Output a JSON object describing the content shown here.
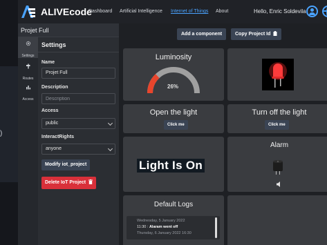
{
  "navbar": {
    "brand": "ALIVEcode",
    "links": [
      "Dashboard",
      "Artificial Intelligence",
      "Internet of Things",
      "About"
    ],
    "active_link": "Internet of Things",
    "user_name": "Hello, Enric Soldevila"
  },
  "project": {
    "title": "Projet Full"
  },
  "side_tabs": [
    {
      "label": "Settings",
      "icon": "gear-icon",
      "active": true
    },
    {
      "label": "Routes",
      "icon": "route-icon",
      "active": false
    },
    {
      "label": "Access",
      "icon": "chart-icon",
      "active": false
    }
  ],
  "settings": {
    "title": "Settings",
    "name_label": "Name",
    "name_value": "Projet Full",
    "description_label": "Description",
    "description_placeholder": "Description",
    "access_label": "Access",
    "access_value": "public",
    "interact_label": "InteractRights",
    "interact_value": "anyone",
    "modify_button": "Modify iot_project",
    "delete_button": "Delete IoT Project"
  },
  "toolbar": {
    "add_component": "Add a component",
    "copy_project_id": "Copy Project Id"
  },
  "components": {
    "luminosity": {
      "title": "Luminosity",
      "value_text": "26%",
      "value": 26
    },
    "led": {
      "icon": "red-led-icon"
    },
    "open_light": {
      "title": "Open the light",
      "button": "Click me"
    },
    "turn_off_light": {
      "title": "Turn off the light",
      "button": "Click me"
    },
    "light_status": {
      "text": "Light Is On"
    },
    "alarm": {
      "title": "Alarm",
      "icons": [
        "buzzer-icon",
        "speaker-icon"
      ]
    },
    "logs": {
      "title": "Default Logs",
      "entries": [
        {
          "date": "Wednesday, 5 January 2022",
          "time": "11:30 :",
          "message": "Alaram went off"
        },
        {
          "date": "Thursday, 6 January 2022 16:30",
          "time": "",
          "message": ""
        }
      ]
    }
  },
  "colors": {
    "accent": "#4aa3ff",
    "danger": "#d9303a",
    "gauge_fill": "#e8452c",
    "gauge_track": "#a0a0a0"
  }
}
